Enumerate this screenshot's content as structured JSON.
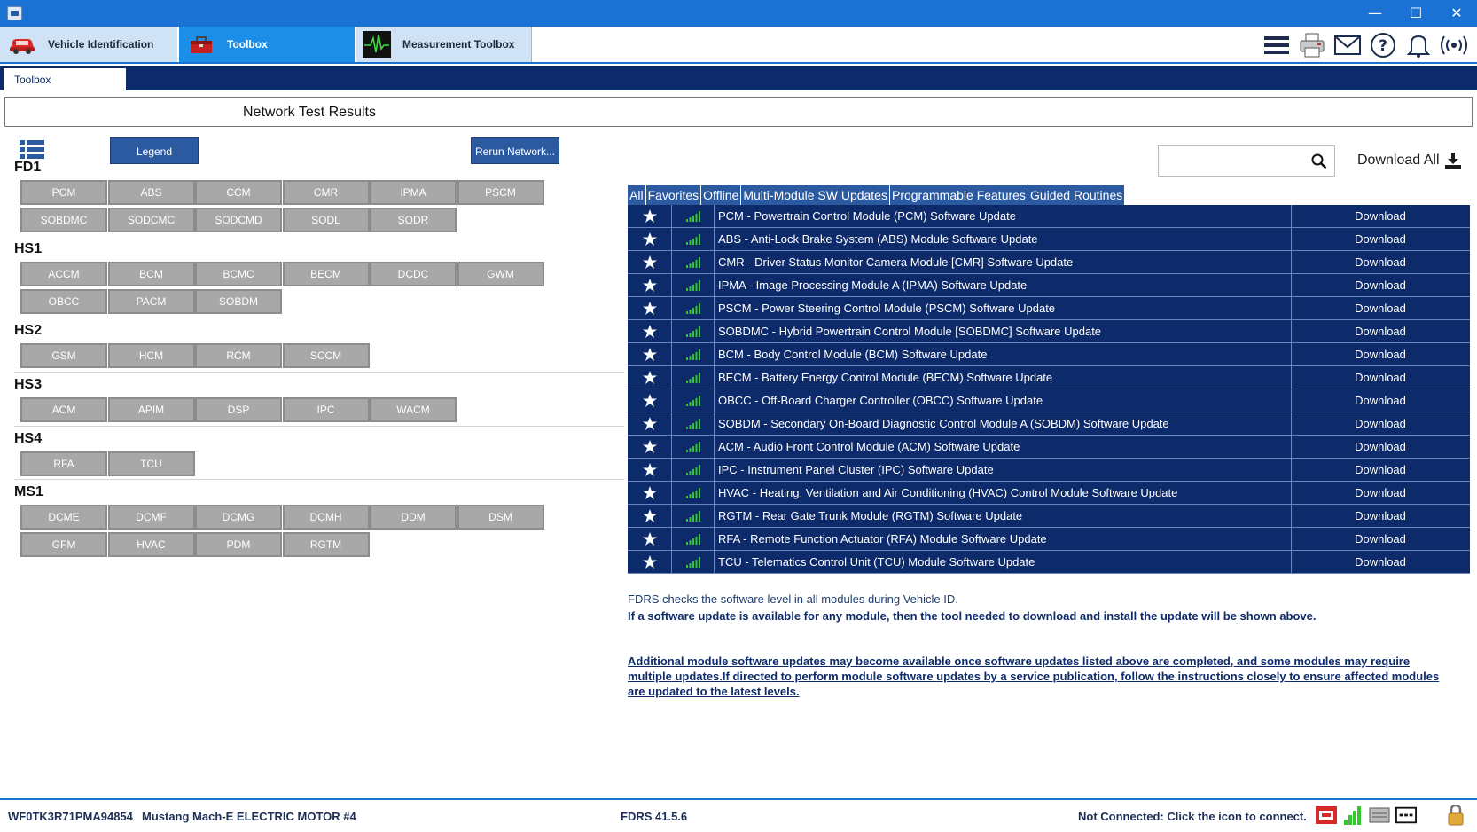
{
  "window": {
    "minimize_glyph": "—",
    "maximize_glyph": "☐",
    "close_glyph": "✕"
  },
  "main_tabs": [
    {
      "label": "Vehicle Identification",
      "icon": "car-icon"
    },
    {
      "label": "Toolbox",
      "icon": "toolbox-icon"
    },
    {
      "label": "Measurement Toolbox",
      "icon": "oscilloscope-icon"
    }
  ],
  "top_icons": [
    "menu-icon",
    "printer-icon",
    "mail-icon",
    "help-icon",
    "bell-icon",
    "wireless-icon"
  ],
  "subtab": {
    "label": "Toolbox"
  },
  "header": {
    "title": "Network Test Results"
  },
  "buttons": {
    "legend": "Legend",
    "rerun": "Rerun Network..."
  },
  "networks": [
    {
      "name": "FD1",
      "rows": [
        [
          "PCM",
          "ABS",
          "CCM",
          "CMR",
          "IPMA",
          "PSCM"
        ],
        [
          "SOBDMC",
          "SODCMC",
          "SODCMD",
          "SODL",
          "SODR"
        ]
      ]
    },
    {
      "name": "HS1",
      "rows": [
        [
          "ACCM",
          "BCM",
          "BCMC",
          "BECM",
          "DCDC",
          "GWM"
        ],
        [
          "OBCC",
          "PACM",
          "SOBDM"
        ]
      ]
    },
    {
      "name": "HS2",
      "rows": [
        [
          "GSM",
          "HCM",
          "RCM",
          "SCCM"
        ]
      ]
    },
    {
      "name": "HS3",
      "rows": [
        [
          "ACM",
          "APIM",
          "DSP",
          "IPC",
          "WACM"
        ]
      ]
    },
    {
      "name": "HS4",
      "rows": [
        [
          "RFA",
          "TCU"
        ]
      ]
    },
    {
      "name": "MS1",
      "rows": [
        [
          "DCME",
          "DCMF",
          "DCMG",
          "DCMH",
          "DDM",
          "DSM"
        ],
        [
          "GFM",
          "HVAC",
          "PDM",
          "RGTM"
        ]
      ]
    }
  ],
  "search": {
    "placeholder": "",
    "value": ""
  },
  "download_all": "Download All",
  "filter_tabs": [
    "All",
    "Favorites",
    "Offline",
    "Multi-Module SW Updates",
    "Programmable Features",
    "Guided Routines"
  ],
  "results": [
    {
      "name": "PCM - Powertrain Control Module (PCM) Software Update",
      "action": "Download"
    },
    {
      "name": "ABS - Anti-Lock Brake System (ABS) Module Software Update",
      "action": "Download"
    },
    {
      "name": "CMR - Driver Status Monitor Camera Module [CMR] Software Update",
      "action": "Download"
    },
    {
      "name": "IPMA - Image Processing Module A (IPMA) Software Update",
      "action": "Download"
    },
    {
      "name": "PSCM - Power Steering Control Module (PSCM) Software Update",
      "action": "Download"
    },
    {
      "name": "SOBDMC - Hybrid Powertrain Control Module [SOBDMC] Software Update",
      "action": "Download"
    },
    {
      "name": "BCM - Body Control Module (BCM) Software Update",
      "action": "Download"
    },
    {
      "name": "BECM - Battery Energy Control Module (BECM) Software Update",
      "action": "Download"
    },
    {
      "name": "OBCC - Off-Board Charger Controller (OBCC) Software Update",
      "action": "Download"
    },
    {
      "name": "SOBDM - Secondary On-Board Diagnostic Control Module A (SOBDM) Software Update",
      "action": "Download"
    },
    {
      "name": "ACM - Audio Front Control Module (ACM) Software Update",
      "action": "Download"
    },
    {
      "name": "IPC - Instrument Panel Cluster (IPC) Software Update",
      "action": "Download"
    },
    {
      "name": "HVAC - Heating, Ventilation and Air Conditioning (HVAC) Control Module Software Update",
      "action": "Download"
    },
    {
      "name": "RGTM - Rear Gate Trunk Module (RGTM) Software Update",
      "action": "Download"
    },
    {
      "name": "RFA - Remote Function Actuator (RFA) Module Software Update",
      "action": "Download"
    },
    {
      "name": "TCU - Telematics Control Unit (TCU) Module Software Update",
      "action": "Download"
    }
  ],
  "info": {
    "line1": "FDRS checks the software level in all modules during Vehicle ID.",
    "line2": "If a software update is available for any module, then the tool needed to download and install the update will be shown above.",
    "line3": "Additional module software updates may become available once software updates listed above are completed, and some modules may require multiple updates.If directed to perform module software updates by a service publication, follow the instructions closely to ensure affected modules are updated to the latest levels."
  },
  "footer": {
    "vin": "WF0TK3R71PMA94854",
    "model": "Mustang Mach-E ELECTRIC MOTOR #4",
    "version": "FDRS 41.5.6",
    "status": "Not Connected: Click the icon to connect."
  },
  "colors": {
    "titlebar": "#1a73d4",
    "navy": "#0d2a6a",
    "button_blue": "#2c5aa0",
    "module_gray": "#a8a8a8",
    "signal_green": "#34c52f"
  }
}
